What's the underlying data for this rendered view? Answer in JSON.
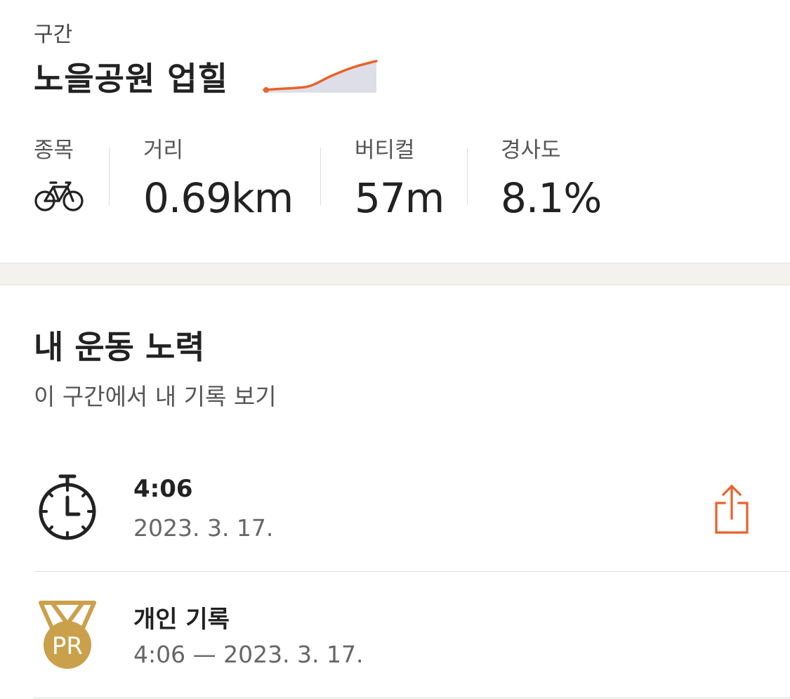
{
  "segment": {
    "kicker": "구간",
    "name": "노을공원 업힐",
    "elevation_color": "#e8622a"
  },
  "stats": [
    {
      "label": "종목",
      "icon": "bike-icon"
    },
    {
      "label": "거리",
      "value": "0.69km"
    },
    {
      "label": "버티컬",
      "value": "57m"
    },
    {
      "label": "경사도",
      "value": "8.1%"
    }
  ],
  "effort": {
    "title": "내 운동 노력",
    "subtitle": "이 구간에서 내 기록 보기",
    "rows": [
      {
        "icon": "stopwatch-icon",
        "primary": "4:06",
        "secondary": "2023. 3. 17.",
        "action_icon": "share-icon"
      },
      {
        "icon": "pr-medal-icon",
        "primary": "개인 기록",
        "secondary": "4:06 — 2023. 3. 17."
      }
    ]
  },
  "colors": {
    "accent": "#e8622a",
    "medal": "#caa04b"
  }
}
